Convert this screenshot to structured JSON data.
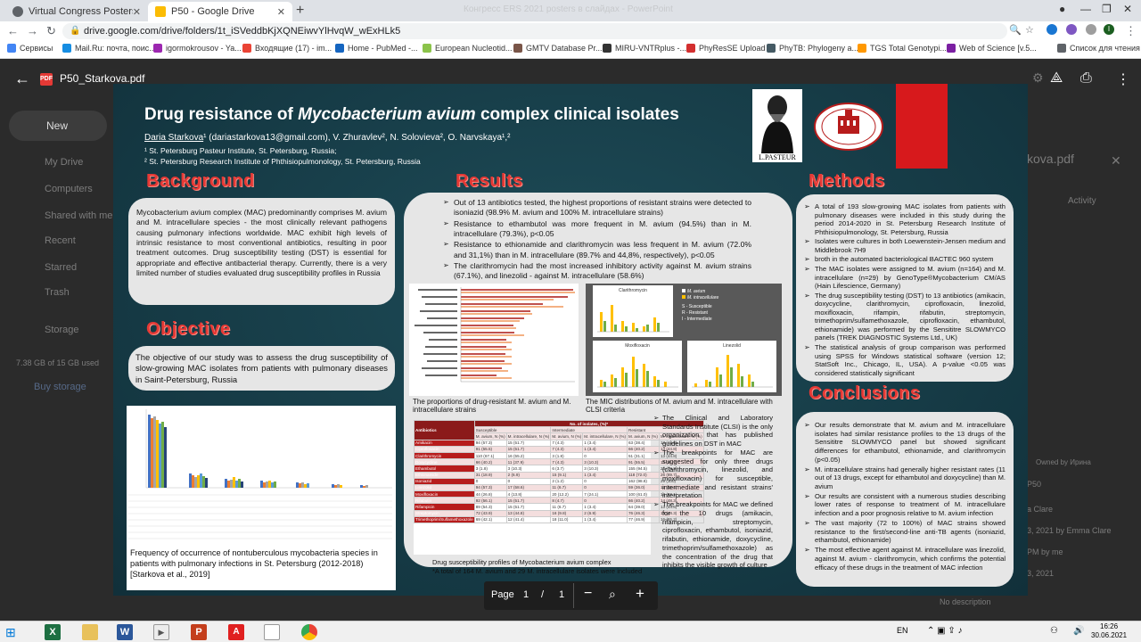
{
  "browser": {
    "tabs": [
      {
        "label": "Virtual Congress Posters 2021",
        "color": "#5f6368"
      },
      {
        "label": "P50 - Google Drive",
        "color": "#fbbc04"
      }
    ],
    "ghost_title": "Конгресс ERS 2021 posters в слайдах - PowerPoint",
    "url": "drive.google.com/drive/folders/1t_iSVeddbKjXQNEiwvYlHvqW_wExHLk5",
    "bookmarks": [
      {
        "label": "Сервисы",
        "color": "#4285f4"
      },
      {
        "label": "Mail.Ru: почта, поис...",
        "color": "#168de2"
      },
      {
        "label": "igormokrousov - Ya...",
        "color": "#9c27b0"
      },
      {
        "label": "Входящие (17) - im...",
        "color": "#ea4335"
      },
      {
        "label": "Home - PubMed -...",
        "color": "#1565c0"
      },
      {
        "label": "European Nucleotid...",
        "color": "#8bc34a"
      },
      {
        "label": "GMTV Database Pr...",
        "color": "#795548"
      },
      {
        "label": "MIRU-VNTRplus -...",
        "color": "#333333"
      },
      {
        "label": "PhyResSE Upload",
        "color": "#d32f2f"
      },
      {
        "label": "PhyTB: Phylogeny a...",
        "color": "#455a64"
      },
      {
        "label": "TGS Total Genotypi...",
        "color": "#ff9800"
      },
      {
        "label": "Web of Science [v.5...",
        "color": "#7b1fa2"
      },
      {
        "label": "Список для чтения",
        "color": "#5f6368"
      }
    ],
    "profile_initial": "I"
  },
  "drive_bg": {
    "new_label": "New",
    "nav": [
      "My Drive",
      "Computers",
      "Shared with me",
      "Recent",
      "Starred",
      "Trash",
      "Storage"
    ],
    "storage": "7.38 GB of 15 GB used",
    "buy": "Buy storage",
    "right_title": "kova.pdf",
    "right_activity": "Activity",
    "right_owner": "Owned by Ирина",
    "right_p50": "P50",
    "right_person": "a Clare",
    "right_date1": "3, 2021 by Emma Clare",
    "right_by": "PM by me",
    "right_date2": "3, 2021",
    "right_desc": "No description"
  },
  "viewer": {
    "file_name": "P50_Starkova.pdf",
    "pdf_badge": "PDF",
    "page_label": "Page",
    "page_current": "1",
    "page_sep": "/",
    "page_total": "1"
  },
  "poster": {
    "title_pre": "Drug resistance of ",
    "title_italic": "Mycobacterium avium",
    "title_post": " complex clinical isolates",
    "author_main": "Daria Starkova",
    "author_rest": "¹ (dariastarkova13@gmail.com), V. Zhuravlev², N. Solovieva², O. Narvskaya¹,²",
    "affil1": "¹ St. Petersburg Pasteur Institute, St. Petersburg, Russia;",
    "affil2": "² St. Petersburg Research Institute of Phthisiopulmonology, St. Petersburg, Russia",
    "pasteur_caption": "L.PASTEUR",
    "headings": {
      "background": "Background",
      "objective": "Objective",
      "results": "Results",
      "methods": "Methods",
      "conclusions": "Conclusions"
    },
    "background_text": "Mycobacterium avium complex (MAC) predominantly comprises M. avium and M. intracellulare species - the most clinically relevant pathogens causing pulmonary infections worldwide. MAC exhibit high levels of intrinsic resistance to most conventional antibiotics, resulting in poor treatment outcomes. Drug susceptibility testing (DST) is essential for appropriate and effective antibacterial therapy. Currently, there is a very limited number of studies evaluated drug susceptibility profiles in Russia",
    "objective_text": "The objective of our study was to assess the drug susceptibility of slow-growing MAC isolates from patients with pulmonary diseases in Saint-Petersburg, Russia",
    "freq_caption": "Frequency of occurrence of nontuberculous mycobacteria species in patients with pulmonary infections in St. Petersburg (2012-2018) [Starkova et al., 2019]",
    "results_bullets": [
      "Out of 13 antibiotics tested, the highest proportions of resistant strains were detected to isoniazid (98.9% M. avium and 100% M. intracellulare strains)",
      "Resistance to ethambutol was more frequent in M. avium (94.5%) than in M. intracellulare (79.3%), p<0.05",
      "Resistance to ethionamide and clarithromycin was less frequent in M. avium (72.0% and 31,1%) than in M. intracellulare (89.7% and 44,8%, respectively), p<0.05",
      "The clarithromycin had the most increased inhibitory activity against M. avium strains (67.1%), and linezolid - against M. intracellulare (58.6%)"
    ],
    "fig_prop_caption": "The proportions of drug-resistant M. avium and M. intracellulare strains",
    "fig_mic_caption": "The MIC distributions of M. avium and M. intracellulare with CLSI criteria",
    "mic_panels": [
      "Clarithromycin",
      "Moxifloxacin",
      "Linezolid"
    ],
    "mic_legend": [
      "M. avium",
      "M. intracellulare",
      "S - Susceptible",
      "R - Resistant",
      "I - Intermediate"
    ],
    "table_caption1": "Drug susceptibility profiles of Mycobacterium avium complex",
    "table_caption2": "*A total of 164 M. avium and 29 M. intracellulare isolates were included",
    "table_head": [
      "Antibiotics",
      "No. of isolates, (%)*"
    ],
    "table_groups": [
      "Susceptible",
      "Intermediate",
      "Resistant"
    ],
    "table_sub": [
      "M. avium, N (%)",
      "M. intracellulare, N (%)",
      "M. avium, N (%)",
      "M. intracellulare, N (%)",
      "M. avium, N (%)",
      "M. intracellulare, N (%)"
    ],
    "table_rows": [
      [
        "Amikacin",
        "94 (57.3)",
        "15 (51.7)",
        "7 (4.3)",
        "1 (3.4)",
        "63 (38.4)",
        "13 (44.8)"
      ],
      [
        "Ciprofloxacin",
        "91 (55.5)",
        "15 (51.7)",
        "7 (4.3)",
        "1 (3.4)",
        "66 (40.2)",
        "13 (44.8)"
      ],
      [
        "Clarithromycin",
        "110 (67.1)",
        "16 (55.2)",
        "3 (1.8)",
        "0",
        "51 (31.1)",
        "13 (44.8)"
      ],
      [
        "Doxycycline",
        "66 (40.2)",
        "11 (37.9)",
        "7 (4.3)",
        "3 (10.3)",
        "91 (55.5)",
        "15 (51.7)"
      ],
      [
        "Ethambutol",
        "3 (1.8)",
        "3 (10.3)",
        "6 (3.7)",
        "3 (10.3)",
        "155 (94.5)",
        "23 (79.3)"
      ],
      [
        "Ethionamide",
        "31 (18.9)",
        "2 (6.9)",
        "15 (9.1)",
        "1 (3.4)",
        "118 (72.0)",
        "26 (89.7)"
      ],
      [
        "Isoniazid",
        "0",
        "0",
        "2 (1.2)",
        "0",
        "162 (98.8)",
        "29 (100)"
      ],
      [
        "Linezolid",
        "94 (57.3)",
        "17 (58.6)",
        "11 (6.7)",
        "0",
        "59 (36.0)",
        "12 (41.4)"
      ],
      [
        "Moxifloxacin",
        "44 (26.8)",
        "4 (13.8)",
        "20 (12.2)",
        "7 (24.1)",
        "100 (61.0)",
        "18 (62.1)"
      ],
      [
        "Rifabutin",
        "92 (56.1)",
        "15 (51.7)",
        "8 (4.7)",
        "0",
        "66 (40.2)",
        "14 (48.3)"
      ],
      [
        "Rifampicin",
        "89 (54.3)",
        "15 (51.7)",
        "11 (6.7)",
        "1 (3.4)",
        "64 (39.0)",
        "13 (44.8)"
      ],
      [
        "Streptomycin",
        "72 (43.9)",
        "13 (44.8)",
        "16 (9.8)",
        "2 (6.9)",
        "76 (46.3)",
        "14 (48.3)"
      ],
      [
        "Trimethoprim/Sulfamethoxazole",
        "69 (42.1)",
        "12 (41.4)",
        "18 (11.0)",
        "1 (3.4)",
        "77 (46.9)",
        "16 (55.2)"
      ]
    ],
    "mid_bullets": [
      "The Clinical and Laboratory Standards Institute (CLSI) is the only organization that has published guidelines on DST in MAC",
      "The breakpoints for MAC are suggested for only three drugs (clarithromycin, linezolid, and moxifloxacin) for susceptible, intermediate and resistant strains' interpretation",
      "The breakpoints for MAC we defined for the 10 drugs (amikacin, rifampicin, streptomycin, ciprofloxacin, ethambutol, isoniazid, rifabutin, ethionamide, doxycycline, trimethoprim/sulfamethoxazole) as the concentration of the drug that inhibits the visible growth of culture"
    ],
    "methods_bullets": [
      "A total of 193 slow-growing MAC isolates from patients with pulmonary diseases were included in this study during the period 2014-2020 in St. Petersburg Research Institute of Phthisiopulmonology, St. Petersburg, Russia",
      "Isolates were cultures in both Loewenstein-Jensen medium and Middlebrook 7H9",
      "broth in the automated bacteriological BACTEC 960 system",
      "The MAC isolates were assigned to M. avium (n=164) and M. intracellulare (n=29) by GenoType®Mycobacterium CM/AS (Hain Lifescience, Germany)",
      "The drug susceptibility testing (DST) to 13 antibiotics (amikacin, doxycycline, clarithromycin, ciprofloxacin, linezolid, moxifloxacin, rifampin, rifabutin, streptomycin, trimethoprim/sulfamethoxazole, ciprofloxacin, ethambutol, ethionamide) was performed by the Sensititre SLOWMYCO panels (TREK DIAGNOSTIC Systems Ltd., UK)",
      "The statistical analysis of group comparison was performed using SPSS for Windows statistical software (version 12; StatSoft Inc., Chicago, IL, USA). A p-value <0.05 was considered statistically significant"
    ],
    "conclusion_bullets": [
      "Our results demonstrate that M. avium and M. intracellulare isolates had similar resistance profiles to the 13 drugs of the Sensititre SLOWMYCO panel but showed significant differences for ethambutol, ethionamide, and clarithromycin (p<0.05)",
      "M. intracellulare strains had generally higher resistant rates (11 out of 13 drugs, except for ethambutol and doxycycline) than M. avium",
      "Our results are consistent with a numerous studies describing lower rates of response to treatment of M. intracellulare infection and a poor prognosis relative to M. avium infection",
      "The vast majority (72 to 100%) of MAC strains showed resistance to the first/second-line anti-TB agents (isoniazid, ethambutol, ethionamide)",
      "The most effective agent against M. intracellulare was linezolid, against M. avium - clarithromycin, which confirms the potential efficacy of these drugs in the treatment of MAC infection"
    ]
  },
  "taskbar": {
    "lang": "EN",
    "time": "16:26",
    "date": "30.06.2021"
  },
  "colors": {
    "poster_bg": "#163b46",
    "section_red": "#e53935",
    "box_bg": "#e6e6e6",
    "table_header": "#8b1a1a"
  }
}
